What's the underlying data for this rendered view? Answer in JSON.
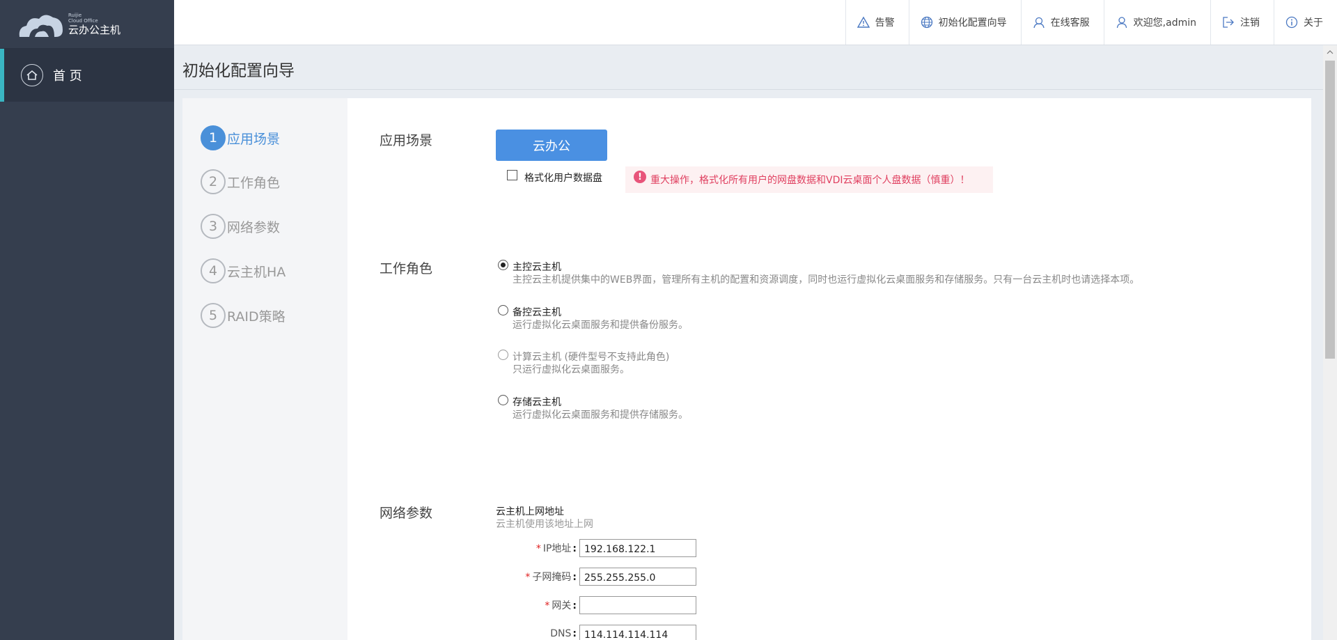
{
  "logo": {
    "brand": "Ruijie",
    "sub": "Cloud Office",
    "name": "云办公主机"
  },
  "sidebar": {
    "home_label": "首 页"
  },
  "topbar": {
    "items": [
      {
        "label": "告警",
        "icon": "warning-icon"
      },
      {
        "label": "初始化配置向导",
        "icon": "globe-icon"
      },
      {
        "label": "在线客服",
        "icon": "headset-icon"
      },
      {
        "label": "欢迎您,admin",
        "icon": "user-icon"
      },
      {
        "label": "注销",
        "icon": "logout-icon"
      },
      {
        "label": "关于",
        "icon": "info-icon"
      }
    ]
  },
  "page": {
    "title": "初始化配置向导"
  },
  "steps": [
    {
      "num": "1",
      "label": "应用场景"
    },
    {
      "num": "2",
      "label": "工作角色"
    },
    {
      "num": "3",
      "label": "网络参数"
    },
    {
      "num": "4",
      "label": "云主机HA"
    },
    {
      "num": "5",
      "label": "RAID策略"
    }
  ],
  "scenario": {
    "label": "应用场景",
    "button": "云办公",
    "format_checkbox": "格式化用户数据盘",
    "warning": "重大操作，格式化所有用户的网盘数据和VDI云桌面个人盘数据（慎重）！"
  },
  "role": {
    "label": "工作角色",
    "options": [
      {
        "title": "主控云主机",
        "desc": "主控云主机提供集中的WEB界面，管理所有主机的配置和资源调度，同时也运行虚拟化云桌面服务和存储服务。只有一台云主机时也请选择本项。"
      },
      {
        "title": "备控云主机",
        "desc": "运行虚拟化云桌面服务和提供备份服务。"
      },
      {
        "title": "计算云主机 (硬件型号不支持此角色)",
        "desc": "只运行虚拟化云桌面服务。"
      },
      {
        "title": "存储云主机",
        "desc": "运行虚拟化云桌面服务和提供存储服务。"
      }
    ]
  },
  "network": {
    "label": "网络参数",
    "heading": "云主机上网地址",
    "subheading": "云主机使用该地址上网",
    "fields": [
      {
        "label": "IP地址",
        "value": "192.168.122.1"
      },
      {
        "label": "子网掩码",
        "value": "255.255.255.0"
      },
      {
        "label": "网关",
        "value": ""
      },
      {
        "label": "DNS",
        "value": "114.114.114.114"
      }
    ]
  }
}
